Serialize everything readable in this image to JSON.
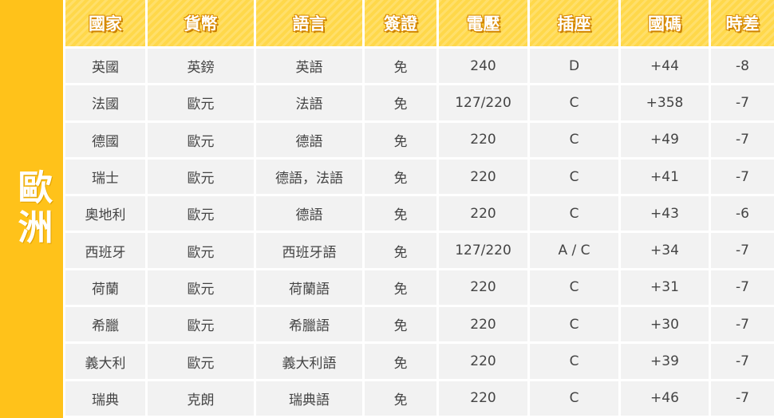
{
  "region": "歐洲",
  "headers": [
    "國家",
    "貨幣",
    "語言",
    "簽證",
    "電壓",
    "插座",
    "國碼",
    "時差"
  ],
  "rows": [
    [
      "英國",
      "英鎊",
      "英語",
      "免",
      "240",
      "D",
      "+44",
      "-8"
    ],
    [
      "法國",
      "歐元",
      "法語",
      "免",
      "127/220",
      "C",
      "+358",
      "-7"
    ],
    [
      "德國",
      "歐元",
      "德語",
      "免",
      "220",
      "C",
      "+49",
      "-7"
    ],
    [
      "瑞士",
      "歐元",
      "德語，法語",
      "免",
      "220",
      "C",
      "+41",
      "-7"
    ],
    [
      "奧地利",
      "歐元",
      "德語",
      "免",
      "220",
      "C",
      "+43",
      "-6"
    ],
    [
      "西班牙",
      "歐元",
      "西班牙語",
      "免",
      "127/220",
      "A / C",
      "+34",
      "-7"
    ],
    [
      "荷蘭",
      "歐元",
      "荷蘭語",
      "免",
      "220",
      "C",
      "+31",
      "-7"
    ],
    [
      "希臘",
      "歐元",
      "希臘語",
      "免",
      "220",
      "C",
      "+30",
      "-7"
    ],
    [
      "義大利",
      "歐元",
      "義大利語",
      "免",
      "220",
      "C",
      "+39",
      "-7"
    ],
    [
      "瑞典",
      "克朗",
      "瑞典語",
      "免",
      "220",
      "C",
      "+46",
      "-7"
    ]
  ],
  "colors": {
    "region_bg": "#ffc21a",
    "header_bg": "#ffd84a",
    "cell_bg": "#f2f2f2",
    "text": "#444444"
  }
}
